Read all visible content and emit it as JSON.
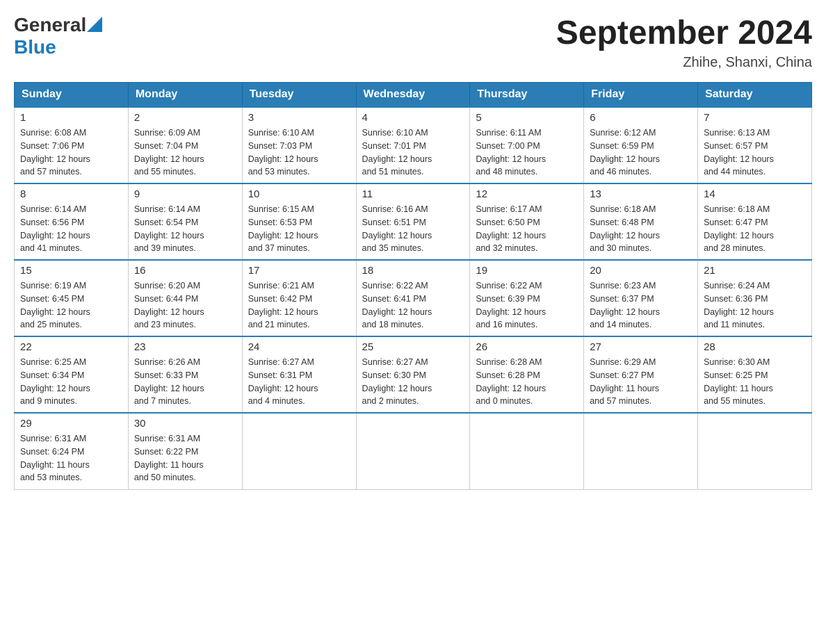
{
  "header": {
    "logo": {
      "general": "General",
      "blue": "Blue"
    },
    "title": "September 2024",
    "location": "Zhihe, Shanxi, China"
  },
  "weekdays": [
    "Sunday",
    "Monday",
    "Tuesday",
    "Wednesday",
    "Thursday",
    "Friday",
    "Saturday"
  ],
  "weeks": [
    [
      {
        "day": "1",
        "sunrise": "6:08 AM",
        "sunset": "7:06 PM",
        "daylight": "12 hours and 57 minutes."
      },
      {
        "day": "2",
        "sunrise": "6:09 AM",
        "sunset": "7:04 PM",
        "daylight": "12 hours and 55 minutes."
      },
      {
        "day": "3",
        "sunrise": "6:10 AM",
        "sunset": "7:03 PM",
        "daylight": "12 hours and 53 minutes."
      },
      {
        "day": "4",
        "sunrise": "6:10 AM",
        "sunset": "7:01 PM",
        "daylight": "12 hours and 51 minutes."
      },
      {
        "day": "5",
        "sunrise": "6:11 AM",
        "sunset": "7:00 PM",
        "daylight": "12 hours and 48 minutes."
      },
      {
        "day": "6",
        "sunrise": "6:12 AM",
        "sunset": "6:59 PM",
        "daylight": "12 hours and 46 minutes."
      },
      {
        "day": "7",
        "sunrise": "6:13 AM",
        "sunset": "6:57 PM",
        "daylight": "12 hours and 44 minutes."
      }
    ],
    [
      {
        "day": "8",
        "sunrise": "6:14 AM",
        "sunset": "6:56 PM",
        "daylight": "12 hours and 41 minutes."
      },
      {
        "day": "9",
        "sunrise": "6:14 AM",
        "sunset": "6:54 PM",
        "daylight": "12 hours and 39 minutes."
      },
      {
        "day": "10",
        "sunrise": "6:15 AM",
        "sunset": "6:53 PM",
        "daylight": "12 hours and 37 minutes."
      },
      {
        "day": "11",
        "sunrise": "6:16 AM",
        "sunset": "6:51 PM",
        "daylight": "12 hours and 35 minutes."
      },
      {
        "day": "12",
        "sunrise": "6:17 AM",
        "sunset": "6:50 PM",
        "daylight": "12 hours and 32 minutes."
      },
      {
        "day": "13",
        "sunrise": "6:18 AM",
        "sunset": "6:48 PM",
        "daylight": "12 hours and 30 minutes."
      },
      {
        "day": "14",
        "sunrise": "6:18 AM",
        "sunset": "6:47 PM",
        "daylight": "12 hours and 28 minutes."
      }
    ],
    [
      {
        "day": "15",
        "sunrise": "6:19 AM",
        "sunset": "6:45 PM",
        "daylight": "12 hours and 25 minutes."
      },
      {
        "day": "16",
        "sunrise": "6:20 AM",
        "sunset": "6:44 PM",
        "daylight": "12 hours and 23 minutes."
      },
      {
        "day": "17",
        "sunrise": "6:21 AM",
        "sunset": "6:42 PM",
        "daylight": "12 hours and 21 minutes."
      },
      {
        "day": "18",
        "sunrise": "6:22 AM",
        "sunset": "6:41 PM",
        "daylight": "12 hours and 18 minutes."
      },
      {
        "day": "19",
        "sunrise": "6:22 AM",
        "sunset": "6:39 PM",
        "daylight": "12 hours and 16 minutes."
      },
      {
        "day": "20",
        "sunrise": "6:23 AM",
        "sunset": "6:37 PM",
        "daylight": "12 hours and 14 minutes."
      },
      {
        "day": "21",
        "sunrise": "6:24 AM",
        "sunset": "6:36 PM",
        "daylight": "12 hours and 11 minutes."
      }
    ],
    [
      {
        "day": "22",
        "sunrise": "6:25 AM",
        "sunset": "6:34 PM",
        "daylight": "12 hours and 9 minutes."
      },
      {
        "day": "23",
        "sunrise": "6:26 AM",
        "sunset": "6:33 PM",
        "daylight": "12 hours and 7 minutes."
      },
      {
        "day": "24",
        "sunrise": "6:27 AM",
        "sunset": "6:31 PM",
        "daylight": "12 hours and 4 minutes."
      },
      {
        "day": "25",
        "sunrise": "6:27 AM",
        "sunset": "6:30 PM",
        "daylight": "12 hours and 2 minutes."
      },
      {
        "day": "26",
        "sunrise": "6:28 AM",
        "sunset": "6:28 PM",
        "daylight": "12 hours and 0 minutes."
      },
      {
        "day": "27",
        "sunrise": "6:29 AM",
        "sunset": "6:27 PM",
        "daylight": "11 hours and 57 minutes."
      },
      {
        "day": "28",
        "sunrise": "6:30 AM",
        "sunset": "6:25 PM",
        "daylight": "11 hours and 55 minutes."
      }
    ],
    [
      {
        "day": "29",
        "sunrise": "6:31 AM",
        "sunset": "6:24 PM",
        "daylight": "11 hours and 53 minutes."
      },
      {
        "day": "30",
        "sunrise": "6:31 AM",
        "sunset": "6:22 PM",
        "daylight": "11 hours and 50 minutes."
      },
      null,
      null,
      null,
      null,
      null
    ]
  ]
}
